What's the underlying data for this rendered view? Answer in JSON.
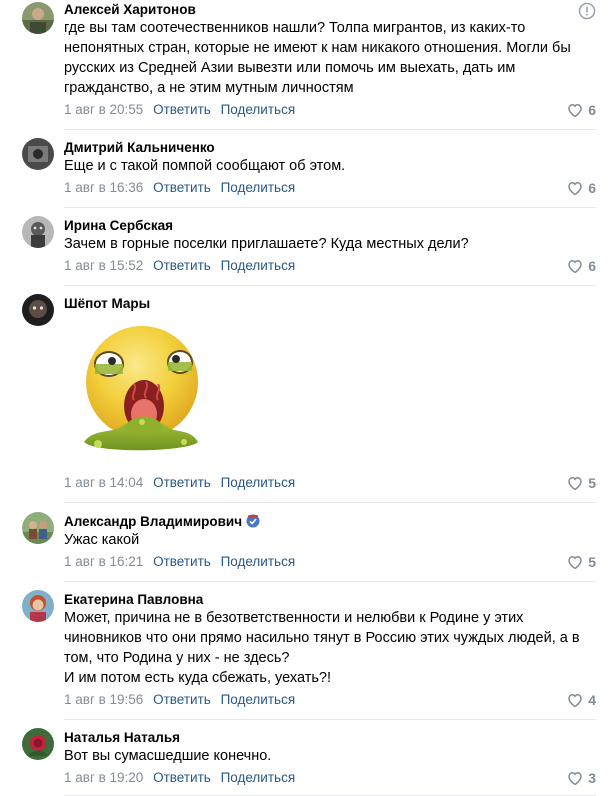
{
  "actions": {
    "reply": "Ответить",
    "share": "Поделиться"
  },
  "comments": [
    {
      "author": "Алексей Харитонов",
      "lines": [
        "где вы там соотечественников нашли? Толпа мигрантов, из каких-то",
        "непонятных стран, которые не имеют к нам никакого отношения. Могли бы",
        "русских из Средней Азии вывезти или помочь им выехать, дать им",
        "гражданство, а не этим мутным личностям"
      ],
      "date": "1 авг в 20:55",
      "likes": "6"
    },
    {
      "author": "Дмитрий Кальниченко",
      "lines": [
        "Еще и с такой помпой сообщают об этом."
      ],
      "date": "1 авг в 16:36",
      "likes": "6"
    },
    {
      "author": "Ирина Сербская",
      "lines": [
        "Зачем в горные поселки приглашаете? Куда местных дели?"
      ],
      "date": "1 авг в 15:52",
      "likes": "6"
    },
    {
      "author": "Шёпот Мары",
      "lines": [],
      "sticker": "vomit-emoji-sticker",
      "date": "1 авг в 14:04",
      "likes": "5"
    },
    {
      "author": "Александр Владимирович",
      "lines": [
        "Ужас какой"
      ],
      "date": "1 авг в 16:21",
      "likes": "5"
    },
    {
      "author": "Екатерина Павловна",
      "lines": [
        "Может, причина не в безответственности и нелюбви к Родине у этих",
        "чиновников что они прямо насильно тянут в Россию этих чуждых людей, а в",
        "том, что Родина у них - не здесь?",
        "И им потом есть куда сбежать, уехать?!"
      ],
      "date": "1 авг в 19:56",
      "likes": "4"
    },
    {
      "author": "Наталья Наталья",
      "lines": [
        "Вот вы сумасшедшие конечно."
      ],
      "date": "1 авг в 19:20",
      "likes": "3"
    }
  ],
  "icons": {
    "like": "heart-outline-icon",
    "more": "exclamation-circle-icon",
    "badge": "shield-badge-icon"
  },
  "colors": {
    "link": "#2a5885",
    "muted": "#818c99",
    "divider": "#e7e8ec"
  }
}
